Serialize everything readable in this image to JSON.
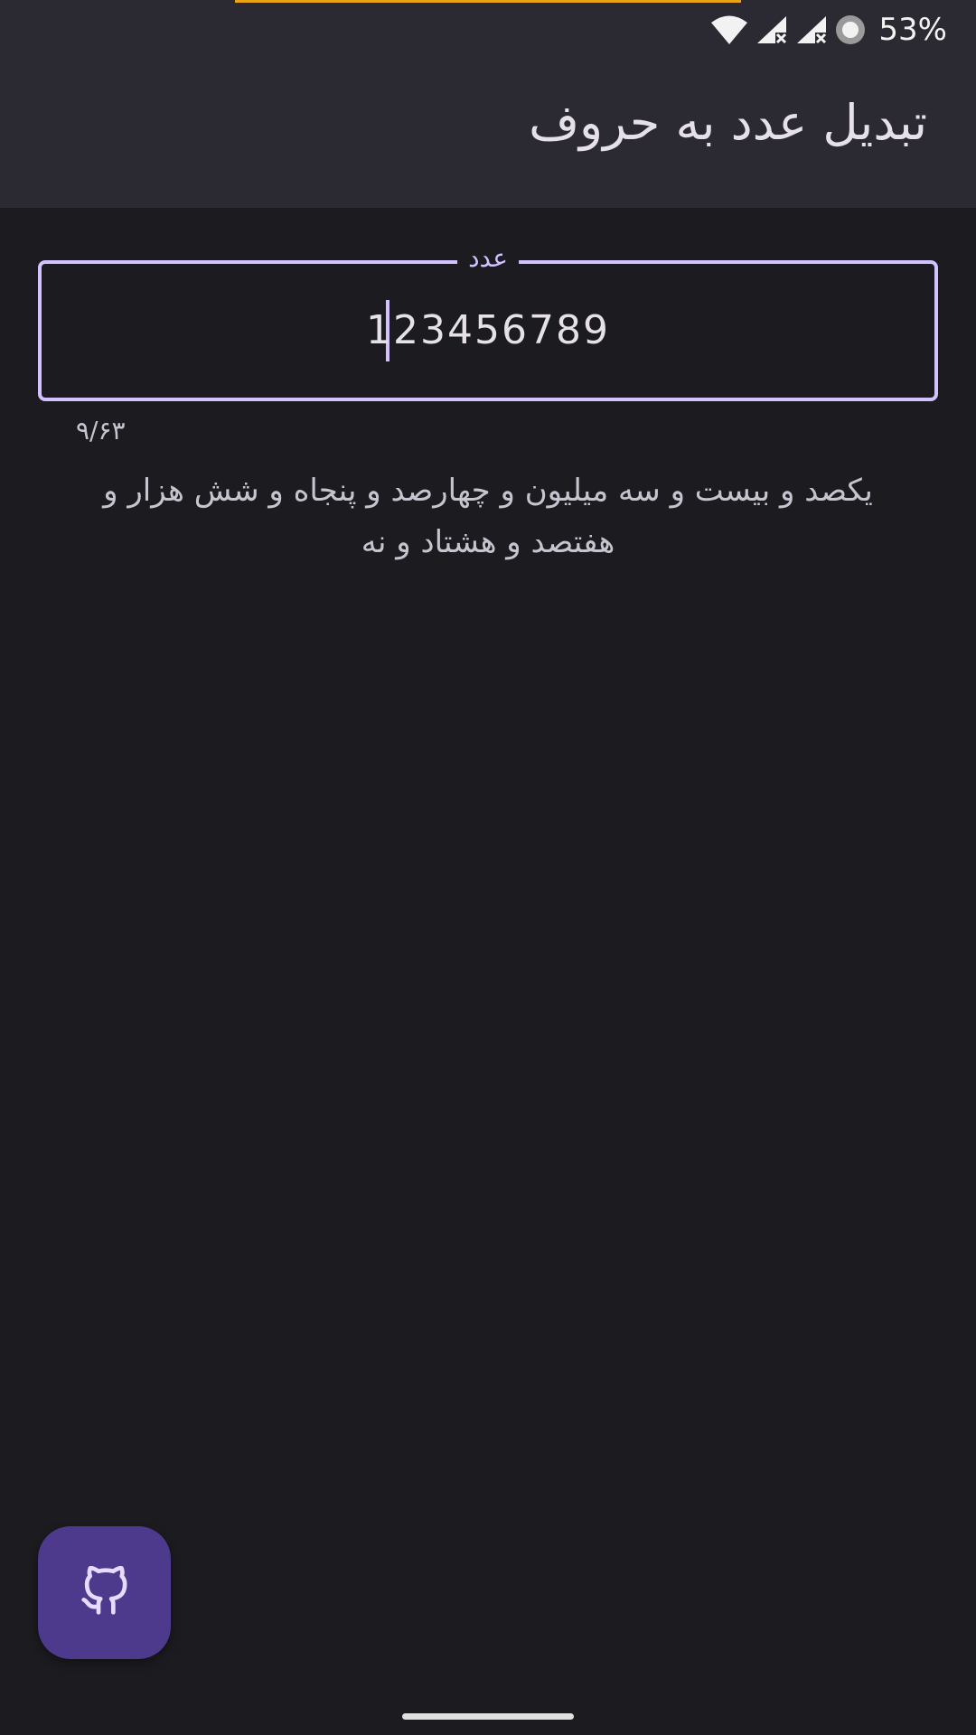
{
  "status_bar": {
    "battery_percent": "53%",
    "icons": [
      "wifi-icon",
      "signal-no-service-icon",
      "signal-no-service-icon",
      "data-saver-icon"
    ]
  },
  "app_bar": {
    "title": "تبدیل عدد به حروف"
  },
  "number_field": {
    "label": "عدد",
    "value": "123456789",
    "counter": "۹/۶۳"
  },
  "result": {
    "text": "یکصد و بیست و سه میلیون  و چهارصد و پنجاه و شش هزار  و هفتصد و هشتاد و نه"
  },
  "fab": {
    "icon": "github-icon"
  },
  "colors": {
    "background": "#1c1b20",
    "app_bar": "#2b2a33",
    "accent": "#d2c2ff",
    "fab": "#4d3a8d",
    "progress": "#e8a317"
  }
}
